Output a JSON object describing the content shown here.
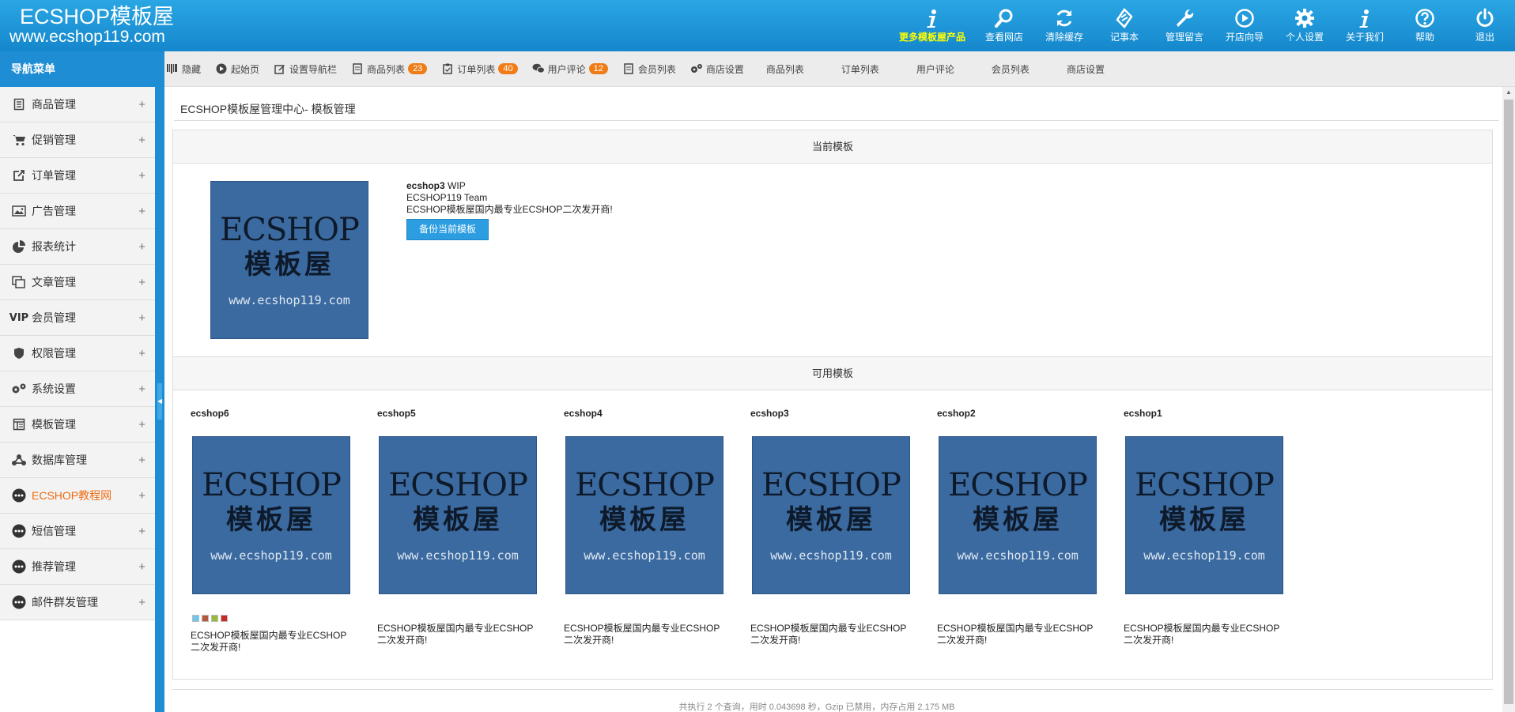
{
  "header": {
    "logo_line1": "ECSHOP模板屋",
    "logo_line2": "www.ecshop119.com",
    "nav": [
      {
        "label": "更多模板屋产品",
        "icon": "info-icon"
      },
      {
        "label": "查看网店",
        "icon": "search-icon"
      },
      {
        "label": "清除缓存",
        "icon": "refresh-icon"
      },
      {
        "label": "记事本",
        "icon": "notepad-icon"
      },
      {
        "label": "管理留言",
        "icon": "wrench-icon"
      },
      {
        "label": "开店向导",
        "icon": "play-icon"
      },
      {
        "label": "个人设置",
        "icon": "gear-icon"
      },
      {
        "label": "关于我们",
        "icon": "info-icon"
      },
      {
        "label": "帮助",
        "icon": "help-icon"
      },
      {
        "label": "退出",
        "icon": "power-icon"
      }
    ]
  },
  "sidebar": {
    "title": "导航菜单",
    "items": [
      {
        "label": "商品管理",
        "icon": "document-icon"
      },
      {
        "label": "促销管理",
        "icon": "cart-icon"
      },
      {
        "label": "订单管理",
        "icon": "export-icon"
      },
      {
        "label": "广告管理",
        "icon": "image-icon"
      },
      {
        "label": "报表统计",
        "icon": "pie-chart-icon"
      },
      {
        "label": "文章管理",
        "icon": "copy-icon"
      },
      {
        "label": "会员管理",
        "icon": "vip-icon"
      },
      {
        "label": "权限管理",
        "icon": "shield-icon"
      },
      {
        "label": "系统设置",
        "icon": "gears-icon"
      },
      {
        "label": "模板管理",
        "icon": "template-icon"
      },
      {
        "label": "数据库管理",
        "icon": "network-icon"
      },
      {
        "label": "ECSHOP教程网",
        "icon": "more-icon"
      },
      {
        "label": "短信管理",
        "icon": "more-icon"
      },
      {
        "label": "推荐管理",
        "icon": "more-icon"
      },
      {
        "label": "邮件群发管理",
        "icon": "more-icon"
      }
    ],
    "plus": "+"
  },
  "toolbar": {
    "items": [
      {
        "label": "隐藏",
        "icon": "barcode-icon"
      },
      {
        "label": "起始页",
        "icon": "play-circle-icon"
      },
      {
        "label": "设置导航栏",
        "icon": "edit-icon"
      },
      {
        "label": "商品列表",
        "icon": "document-icon",
        "badge": "23"
      },
      {
        "label": "订单列表",
        "icon": "clipboard-icon",
        "badge": "40"
      },
      {
        "label": "用户评论",
        "icon": "chat-icon",
        "badge": "12"
      },
      {
        "label": "会员列表",
        "icon": "document-icon"
      },
      {
        "label": "商店设置",
        "icon": "gears-icon"
      }
    ],
    "plain": [
      "商品列表",
      "订单列表",
      "用户评论",
      "会员列表",
      "商店设置"
    ]
  },
  "main": {
    "breadcrumb": "ECSHOP模板屋管理中心- 模板管理",
    "current_title": "当前模板",
    "current": {
      "name": "ecshop3",
      "version": "WIP",
      "author": "ECSHOP119 Team",
      "desc": "ECSHOP模板屋国内最专业ECSHOP二次发开商!",
      "backup_button": "备份当前模板"
    },
    "thumb_text": {
      "line1": "ECSHOP",
      "line2": "模板屋",
      "line3": "www.ecshop119.com"
    },
    "available_title": "可用模板",
    "templates": [
      {
        "name": "ecshop6",
        "desc1": "ECSHOP模板屋国内最专业ECSHOP",
        "desc2": "二次发开商!"
      },
      {
        "name": "ecshop5",
        "desc1": "ECSHOP模板屋国内最专业ECSHOP",
        "desc2": "二次发开商!"
      },
      {
        "name": "ecshop4",
        "desc1": "ECSHOP模板屋国内最专业ECSHOP",
        "desc2": "二次发开商!"
      },
      {
        "name": "ecshop3",
        "desc1": "ECSHOP模板屋国内最专业ECSHOP",
        "desc2": "二次发开商!"
      },
      {
        "name": "ecshop2",
        "desc1": "ECSHOP模板屋国内最专业ECSHOP",
        "desc2": "二次发开商!"
      },
      {
        "name": "ecshop1",
        "desc1": "ECSHOP模板屋国内最专业ECSHOP",
        "desc2": "二次发开商!"
      }
    ],
    "swatch_colors": [
      "#6ec6ef",
      "#b45a3c",
      "#9ab83a",
      "#c82a2a"
    ]
  },
  "footer": {
    "text": "共执行 2 个查询，用时 0.043698 秒，Gzip 已禁用，内存占用 2.175 MB"
  },
  "colors": {
    "header": "#1e8dd4",
    "accent": "#f07c18",
    "active_menu": "#f06b0f",
    "thumb_bg": "#3b6aa0"
  }
}
